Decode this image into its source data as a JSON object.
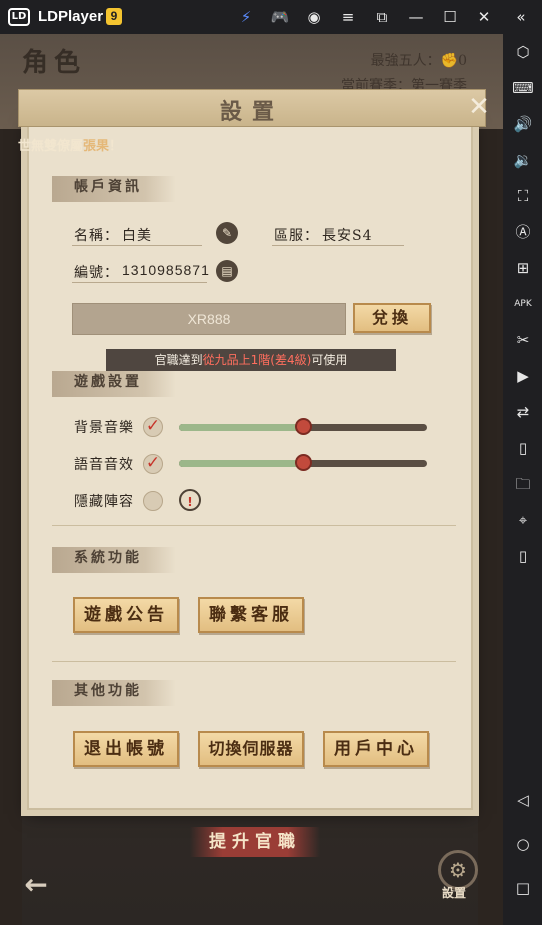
{
  "titlebar": {
    "app_name": "LDPlayer",
    "version_badge": "9",
    "icons": [
      "bolt-icon",
      "gamepad-icon",
      "user-icon",
      "menu-icon",
      "restore-icon",
      "minimize-icon",
      "maximize-icon",
      "close-icon",
      "collapse-icon"
    ]
  },
  "sidebar": {
    "icons": [
      "settings-icon",
      "keyboard-icon",
      "volume-up-icon",
      "volume-down-icon",
      "fullscreen-icon",
      "rotate-a-icon",
      "add-window-icon",
      "apk-icon",
      "scissors-icon",
      "video-record-icon",
      "sync-icon",
      "shake-icon",
      "folder-icon",
      "location-icon",
      "vibrate-icon",
      "back-icon",
      "home-icon",
      "recent-icon"
    ]
  },
  "game": {
    "role_title": "角色",
    "strongest_five_label": "最強五人：",
    "strongest_five_value": "0",
    "season_label": "當前賽季：第一賽季",
    "ticker_prefix": "世無雙",
    "ticker_mid": "僚屬",
    "ticker_name": "張果",
    "ticker_suffix": "！"
  },
  "panel": {
    "title": "設置",
    "account": {
      "header": "帳戶資訊",
      "name_label": "名稱：",
      "name_value": "白美",
      "server_label": "區服：",
      "server_value": "長安S4",
      "id_label": "編號：",
      "id_value": "1310985871",
      "code_value": "XR888",
      "redeem_label": "兌換",
      "rank_note_prefix": "官職達到",
      "rank_note_red": "從九品上1階(差4級)",
      "rank_note_suffix": "可使用"
    },
    "game_settings": {
      "header": "遊戲設置",
      "bgm_label": "背景音樂",
      "bgm_checked": true,
      "bgm_level": 0.5,
      "voice_label": "語音音效",
      "voice_checked": true,
      "voice_level": 0.5,
      "hide_label": "隱藏陣容",
      "hide_checked": false
    },
    "system": {
      "header": "系統功能",
      "notice_button": "遊戲公告",
      "support_button": "聯繫客服"
    },
    "other": {
      "header": "其他功能",
      "logout_button": "退出帳號",
      "switch_server_button": "切換伺服器",
      "user_center_button": "用戶中心"
    }
  },
  "bottom": {
    "promote_label": "提升官職",
    "settings_label": "設置"
  },
  "colors": {
    "panel_bg": "#eae0cc",
    "gold_button": "#e2be81",
    "accent_red": "#c24a3c",
    "slider_fill": "#9cb78a"
  }
}
